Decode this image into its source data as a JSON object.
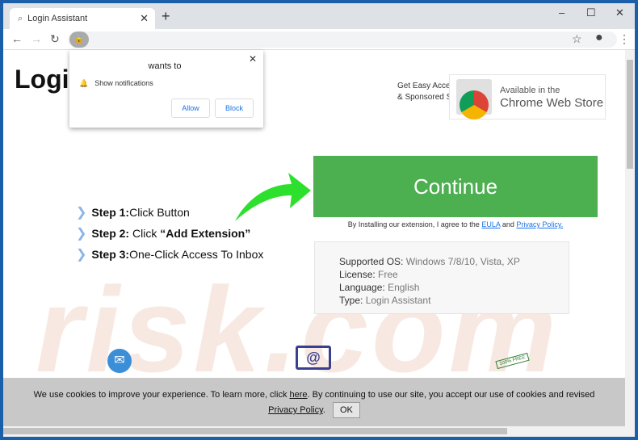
{
  "browser": {
    "tab_title": "Login Assistant",
    "new_tab": "+",
    "minimize": "‒",
    "maximize": "☐",
    "close": "✕"
  },
  "popup": {
    "wants": "wants to",
    "permission": "Show notifications",
    "allow": "Allow",
    "block": "Block",
    "close": "✕"
  },
  "page": {
    "title": "Login",
    "get_easy": [
      "Get Easy Acces",
      "& Sponsored S"
    ],
    "cws": {
      "line1": "Available in the",
      "line2": "Chrome Web Store"
    },
    "continue": "Continue",
    "agree": {
      "text": "By Installing our extension, I agree to the",
      "eula": "EULA",
      "and": "and",
      "privacy": "Privacy Policy."
    },
    "steps": [
      {
        "label": "Step 1:",
        "text": " Click Button"
      },
      {
        "label": "Step 2:",
        "text": " Click ",
        "bold": "“Add Extension”"
      },
      {
        "label": "Step 3:",
        "text": " One-Click Access To Inbox"
      }
    ],
    "info": [
      {
        "k": "Supported OS:",
        "v": " Windows 7/8/10, Vista, XP"
      },
      {
        "k": "License:",
        "v": " Free"
      },
      {
        "k": "Language:",
        "v": " English"
      },
      {
        "k": "Type:",
        "v": " Login Assistant"
      }
    ],
    "free_badge": "100% FREE",
    "watermark": "risk.com"
  },
  "cookie": {
    "text1": "We use cookies to improve your experience. To learn more, click",
    "here": "here",
    "text2": ". By continuing to use our site, you accept our use of cookies and revised",
    "privacy": "Privacy Policy",
    "dot": ".",
    "ok": "OK"
  }
}
